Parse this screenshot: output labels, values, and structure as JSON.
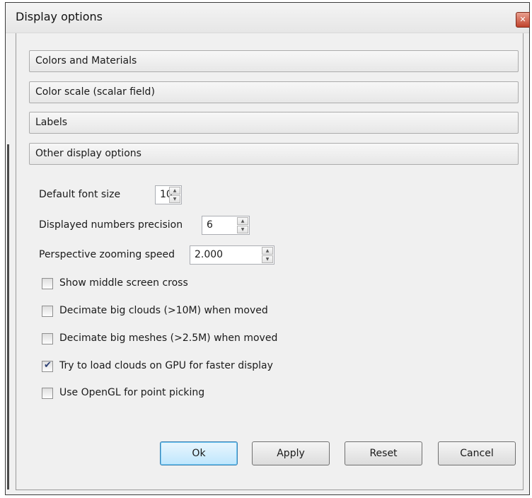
{
  "window": {
    "title": "Display options",
    "close_icon": "close-icon"
  },
  "sections": [
    {
      "label": "Colors and Materials"
    },
    {
      "label": "Color scale (scalar field)"
    },
    {
      "label": "Labels"
    },
    {
      "label": "Other display options"
    }
  ],
  "options": {
    "font_size": {
      "label": "Default font size",
      "value": "10"
    },
    "precision": {
      "label": "Displayed numbers precision",
      "value": "6"
    },
    "zoom_speed": {
      "label": "Perspective zooming speed",
      "value": "2.000"
    }
  },
  "checkboxes": [
    {
      "label": "Show middle screen cross",
      "checked": false
    },
    {
      "label": "Decimate big clouds (>10M) when moved",
      "checked": false
    },
    {
      "label": "Decimate big meshes (>2.5M) when moved",
      "checked": false
    },
    {
      "label": "Try to load clouds on GPU for faster display",
      "checked": true
    },
    {
      "label": "Use OpenGL for point picking",
      "checked": false
    }
  ],
  "buttons": {
    "ok": "Ok",
    "apply": "Apply",
    "reset": "Reset",
    "cancel": "Cancel"
  },
  "colors": {
    "default_button_border": "#3c7fb1",
    "close_button": "#c0432c"
  }
}
